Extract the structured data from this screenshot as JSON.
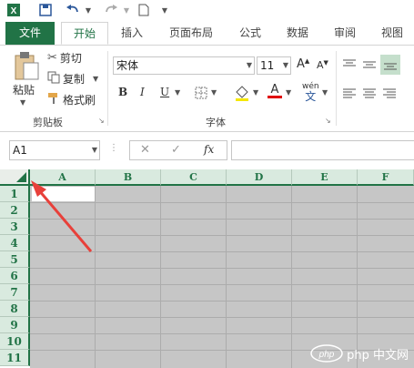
{
  "qat": {
    "excel_icon": "excel-logo-icon",
    "save_icon": "save-icon",
    "undo_icon": "undo-icon",
    "redo_icon": "redo-icon",
    "new_icon": "new-file-icon",
    "customize_icon": "customize-icon"
  },
  "tabs": [
    {
      "label": "文件",
      "kind": "file"
    },
    {
      "label": "开始",
      "kind": "active"
    },
    {
      "label": "插入",
      "kind": "normal"
    },
    {
      "label": "页面布局",
      "kind": "normal"
    },
    {
      "label": "公式",
      "kind": "normal"
    },
    {
      "label": "数据",
      "kind": "normal"
    },
    {
      "label": "审阅",
      "kind": "normal"
    },
    {
      "label": "视图",
      "kind": "normal"
    }
  ],
  "clipboard": {
    "paste_label": "粘贴",
    "cut_label": "剪切",
    "copy_label": "复制",
    "format_painter_label": "格式刷",
    "group_label": "剪贴板"
  },
  "font": {
    "name": "宋体",
    "size": "11",
    "grow": "A",
    "shrink": "A",
    "bold": "B",
    "italic": "I",
    "underline": "U",
    "font_color_letter": "A",
    "phonetic_top": "wén",
    "phonetic_bottom": "文",
    "group_label": "字体"
  },
  "formula_bar": {
    "name_box": "A1",
    "cancel": "✕",
    "confirm": "✓",
    "fx": "fx",
    "value": ""
  },
  "grid": {
    "columns": [
      "A",
      "B",
      "C",
      "D",
      "E",
      "F"
    ],
    "rows": [
      "1",
      "2",
      "3",
      "4",
      "5",
      "6",
      "7",
      "8",
      "9",
      "10",
      "11"
    ]
  },
  "watermark": {
    "text": "php 中文网",
    "logo": "php"
  },
  "colors": {
    "excel_green": "#217346",
    "selected_cells": "#c6c6c6",
    "header_fill": "#d9eadf",
    "arrow_red": "#e8403a"
  }
}
